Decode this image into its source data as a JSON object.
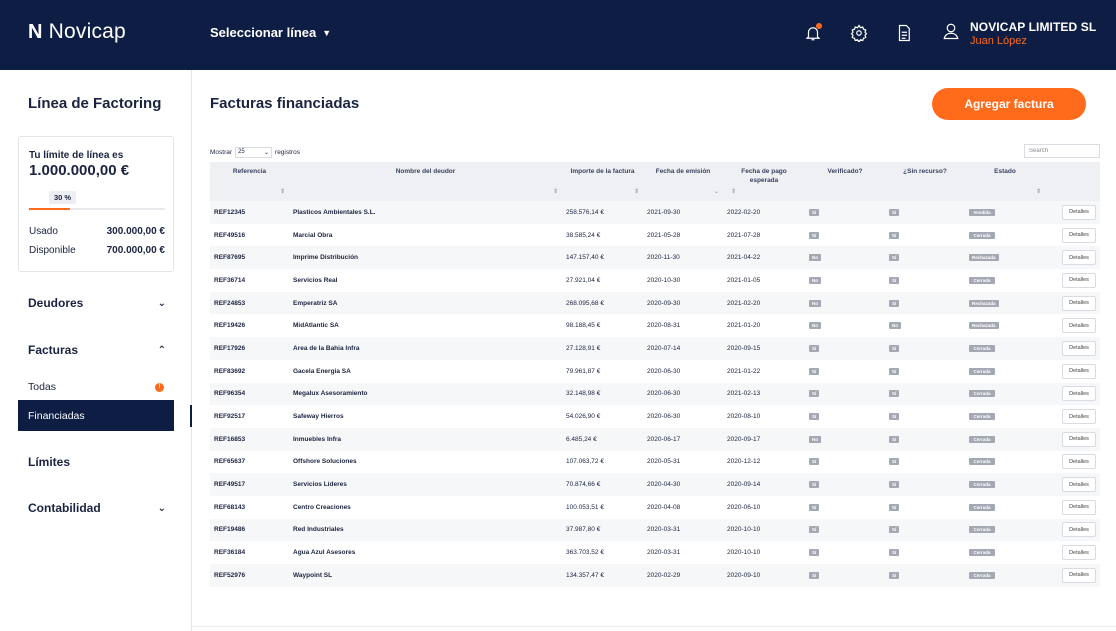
{
  "header": {
    "logo_mark": "N",
    "logo_text": "Novicap",
    "line_select": "Seleccionar línea",
    "company": "NOVICAP LIMITED SL",
    "user_name": "Juan López"
  },
  "sidebar": {
    "title": "Línea de Factoring",
    "limit_label": "Tu límite de línea es",
    "limit_amount": "1.000.000,00 €",
    "progress_label": "30 %",
    "progress_fraction": 0.3,
    "used_label": "Usado",
    "used_value": "300.000,00 €",
    "available_label": "Disponible",
    "available_value": "700.000,00 €",
    "nav": {
      "deudores": "Deudores",
      "facturas": "Facturas",
      "todas": "Todas",
      "todas_badge": "!",
      "financiadas": "Financiadas",
      "limites": "Límites",
      "contabilidad": "Contabilidad"
    }
  },
  "main": {
    "title": "Facturas financiadas",
    "add_button": "Agregar factura",
    "show_prefix": "Mostrar",
    "show_value": "25",
    "show_suffix": "registros",
    "search_placeholder": "Search",
    "columns": {
      "ref": "Referencia",
      "debtor": "Nombre del deudor",
      "amount": "Importe de la factura",
      "issue": "Fecha de emisión",
      "due": "Fecha de pago esperada",
      "verified": "Verificado?",
      "recourse": "¿Sin recurso?",
      "status": "Estado"
    },
    "details_label": "Detalles",
    "rows": [
      {
        "ref": "REF12345",
        "debtor": "Plasticos Ambientales S.L.",
        "amount": "258.576,14 €",
        "issue": "2021-09-30",
        "due": "2022-02-20",
        "verified": "Sí",
        "recourse": "Sí",
        "status": "Vendida"
      },
      {
        "ref": "REF49516",
        "debtor": "Marcial Obra",
        "amount": "38.585,24 €",
        "issue": "2021-05-28",
        "due": "2021-07-28",
        "verified": "Sí",
        "recourse": "Sí",
        "status": "Cerrada"
      },
      {
        "ref": "REF87695",
        "debtor": "Imprime Distribución",
        "amount": "147.157,40 €",
        "issue": "2020-11-30",
        "due": "2021-04-22",
        "verified": "No",
        "recourse": "Sí",
        "status": "Rechazada"
      },
      {
        "ref": "REF36714",
        "debtor": "Servicios Real",
        "amount": "27.921,04 €",
        "issue": "2020-10-30",
        "due": "2021-01-05",
        "verified": "No",
        "recourse": "Sí",
        "status": "Cerrada"
      },
      {
        "ref": "REF24853",
        "debtor": "Emperatriz SA",
        "amount": "268.095,68 €",
        "issue": "2020-09-30",
        "due": "2021-02-20",
        "verified": "No",
        "recourse": "Sí",
        "status": "Rechazada"
      },
      {
        "ref": "REF19426",
        "debtor": "MidAtlantic SA",
        "amount": "98.188,45 €",
        "issue": "2020-08-31",
        "due": "2021-01-20",
        "verified": "No",
        "recourse": "No",
        "status": "Rechazada"
      },
      {
        "ref": "REF17926",
        "debtor": "Area de la Bahia Infra",
        "amount": "27.128,91 €",
        "issue": "2020-07-14",
        "due": "2020-09-15",
        "verified": "Sí",
        "recourse": "Sí",
        "status": "Cerrada"
      },
      {
        "ref": "REF83692",
        "debtor": "Gacela Energia SA",
        "amount": "79.961,87 €",
        "issue": "2020-06-30",
        "due": "2021-01-22",
        "verified": "Sí",
        "recourse": "Sí",
        "status": "Cerrada"
      },
      {
        "ref": "REF96354",
        "debtor": "Megalux Asesoramiento",
        "amount": "32.148,98 €",
        "issue": "2020-06-30",
        "due": "2021-02-13",
        "verified": "Sí",
        "recourse": "Sí",
        "status": "Cerrada"
      },
      {
        "ref": "REF92517",
        "debtor": "Safeway Hierros",
        "amount": "54.026,90 €",
        "issue": "2020-06-30",
        "due": "2020-08-10",
        "verified": "Sí",
        "recourse": "Sí",
        "status": "Cerrada"
      },
      {
        "ref": "REF16853",
        "debtor": "Inmuebles Infra",
        "amount": "6.485,24 €",
        "issue": "2020-06-17",
        "due": "2020-09-17",
        "verified": "No",
        "recourse": "Sí",
        "status": "Cerrada"
      },
      {
        "ref": "REF65637",
        "debtor": "Offshore Soluciones",
        "amount": "107.063,72 €",
        "issue": "2020-05-31",
        "due": "2020-12-12",
        "verified": "Sí",
        "recourse": "Sí",
        "status": "Cerrada"
      },
      {
        "ref": "REF49517",
        "debtor": "Servicios Líderes",
        "amount": "70.874,66 €",
        "issue": "2020-04-30",
        "due": "2020-09-14",
        "verified": "Sí",
        "recourse": "Sí",
        "status": "Cerrada"
      },
      {
        "ref": "REF68143",
        "debtor": "Centro Creaciones",
        "amount": "100.053,51 €",
        "issue": "2020-04-08",
        "due": "2020-06-10",
        "verified": "Sí",
        "recourse": "Sí",
        "status": "Cerrada"
      },
      {
        "ref": "REF19486",
        "debtor": "Red Industriales",
        "amount": "37.987,80 €",
        "issue": "2020-03-31",
        "due": "2020-10-10",
        "verified": "Sí",
        "recourse": "Sí",
        "status": "Cerrada"
      },
      {
        "ref": "REF36184",
        "debtor": "Agua Azul Asesores",
        "amount": "363.703,52 €",
        "issue": "2020-03-31",
        "due": "2020-10-10",
        "verified": "Sí",
        "recourse": "Sí",
        "status": "Cerrada"
      },
      {
        "ref": "REF52976",
        "debtor": "Waypoint SL",
        "amount": "134.357,47 €",
        "issue": "2020-02-29",
        "due": "2020-09-10",
        "verified": "Sí",
        "recourse": "Sí",
        "status": "Cerrada"
      }
    ]
  }
}
